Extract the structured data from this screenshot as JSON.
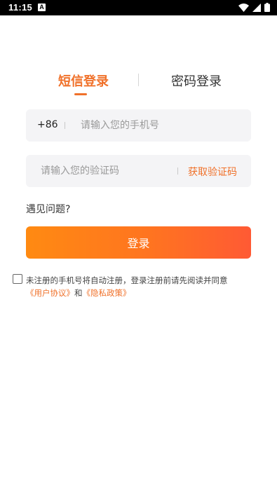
{
  "status_bar": {
    "time": "11:15",
    "notification_badge": "A",
    "icons": [
      "wifi-icon",
      "signal-icon",
      "battery-icon"
    ]
  },
  "tabs": {
    "sms": "短信登录",
    "password": "密码登录",
    "active": "sms"
  },
  "phone": {
    "country_code": "+86",
    "placeholder": "请输入您的手机号",
    "value": ""
  },
  "code": {
    "placeholder": "请输入您的验证码",
    "value": "",
    "get_code_label": "获取验证码"
  },
  "problem_link": "遇见问题?",
  "login_button": "登录",
  "agreement": {
    "checked": false,
    "text": "未注册的手机号将自动注册，登录注册前请先阅读并同意",
    "user_agreement": "《用户协议》",
    "and": "和",
    "privacy_policy": "《隐私政策》"
  },
  "colors": {
    "accent": "#f0712a",
    "button_gradient_start": "#ff8a12",
    "button_gradient_end": "#ff5a34",
    "field_background": "#f4f4f6"
  }
}
